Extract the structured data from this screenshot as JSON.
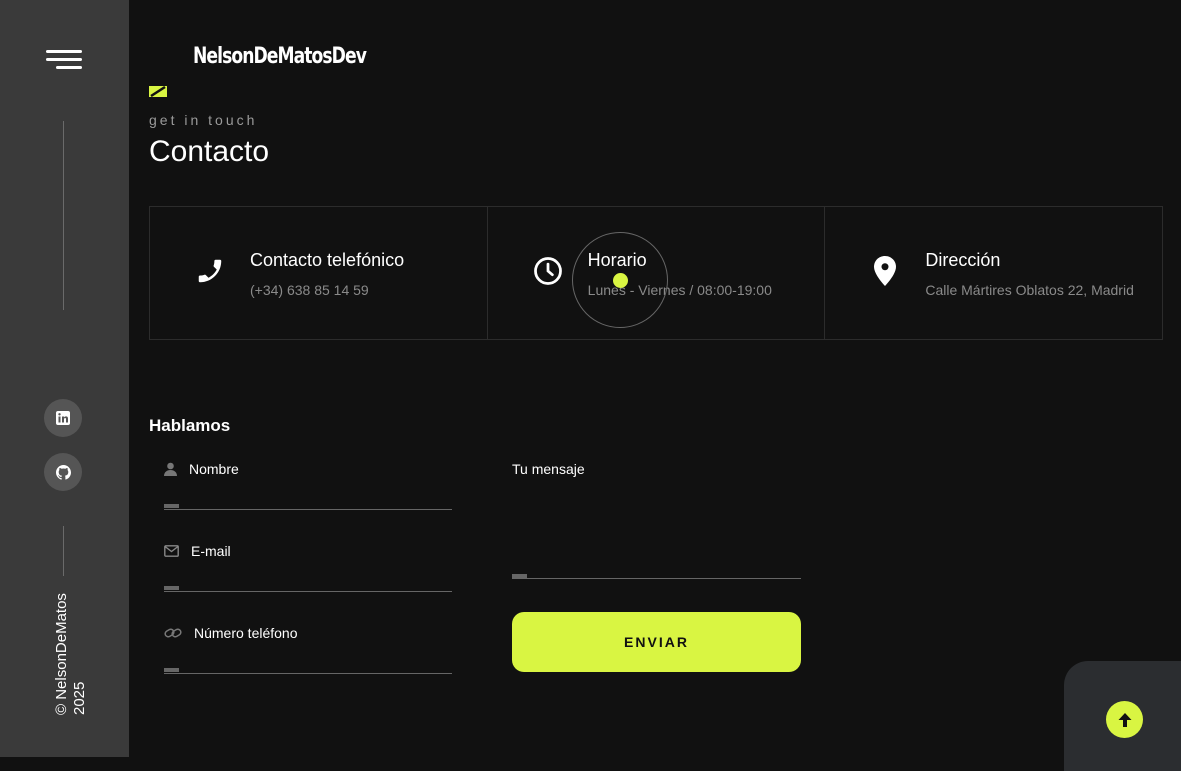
{
  "brand": {
    "logo": "NelsonDeMatosDev"
  },
  "sidebar": {
    "menu_icon": "hamburger-menu-icon",
    "social": [
      {
        "name": "linkedin-icon"
      },
      {
        "name": "github-icon"
      }
    ],
    "copyright": "© NelsonDeMatos",
    "year": "2025"
  },
  "header": {
    "eyebrow": "get in touch",
    "title": "Contacto"
  },
  "cards": [
    {
      "icon": "phone-icon",
      "title": "Contacto telefónico",
      "value": "(+34) 638 85 14 59"
    },
    {
      "icon": "clock-icon",
      "title": "Horario",
      "value": "Lunes - Viernes / 08:00-19:00"
    },
    {
      "icon": "map-pin-icon",
      "title": "Dirección",
      "value": "Calle Mártires Oblatos 22, Madrid"
    }
  ],
  "form": {
    "title": "Hablamos",
    "fields": [
      {
        "icon": "user-icon",
        "label": "Nombre"
      },
      {
        "icon": "mail-icon",
        "label": "E-mail"
      },
      {
        "icon": "link-icon",
        "label": "Número teléfono"
      }
    ],
    "message_label": "Tu mensaje",
    "submit_label": "ENVIAR"
  },
  "back_to_top_icon": "arrow-up-icon",
  "colors": {
    "accent": "#d9f542",
    "background": "#111111",
    "sidebar": "#3a3a3a",
    "muted_text": "#8a8a8a"
  }
}
